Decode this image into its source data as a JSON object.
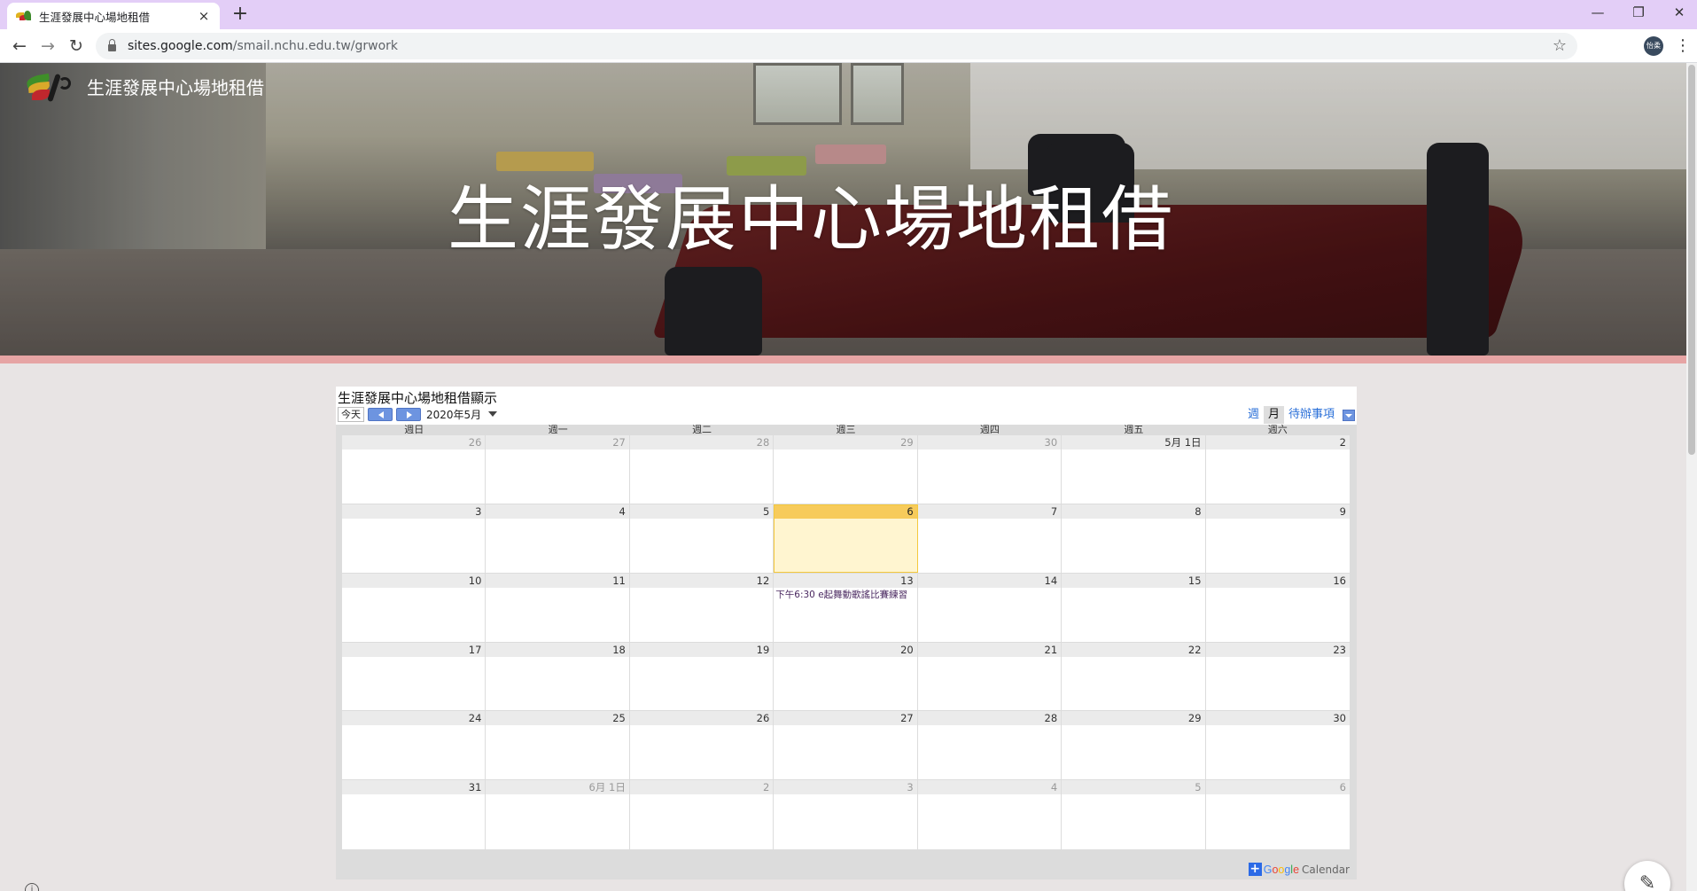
{
  "browser": {
    "tab_title": "生涯發展中心場地租借",
    "tab_close": "×",
    "new_tab": "+",
    "url_domain": "sites.google.com",
    "url_path": "/smail.nchu.edu.tw/grwork",
    "avatar_text": "怡柔",
    "controls": {
      "minimize": "—",
      "restore": "❐",
      "close": "✕"
    },
    "nav": {
      "back": "←",
      "forward": "→",
      "reload": "↻",
      "star": "☆",
      "menu": "⋮"
    }
  },
  "site": {
    "name": "生涯發展中心場地租借",
    "hero_title": "生涯發展中心場地租借",
    "accent_color": "#e6a4a4"
  },
  "calendar": {
    "title": "生涯發展中心場地租借顯示",
    "today_button": "今天",
    "month_label": "2020年5月",
    "views": {
      "week": "週",
      "month": "月",
      "agenda": "待辦事項"
    },
    "weekdays": [
      "週日",
      "週一",
      "週二",
      "週三",
      "週四",
      "週五",
      "週六"
    ],
    "weeks": [
      [
        "26",
        "27",
        "28",
        "29",
        "30",
        "5月 1日",
        "2"
      ],
      [
        "3",
        "4",
        "5",
        "6",
        "7",
        "8",
        "9"
      ],
      [
        "10",
        "11",
        "12",
        "13",
        "14",
        "15",
        "16"
      ],
      [
        "17",
        "18",
        "19",
        "20",
        "21",
        "22",
        "23"
      ],
      [
        "24",
        "25",
        "26",
        "27",
        "28",
        "29",
        "30"
      ],
      [
        "31",
        "6月 1日",
        "2",
        "3",
        "4",
        "5",
        "6"
      ]
    ],
    "other_month_cells": [
      "0-0",
      "0-1",
      "0-2",
      "0-3",
      "0-4",
      "5-1",
      "5-2",
      "5-3",
      "5-4",
      "5-5",
      "5-6"
    ],
    "today_cell": "1-3",
    "event": {
      "cell": "2-3",
      "text": "下午6:30 e起舞動歌謠比賽練習"
    },
    "footer": {
      "plus": "+",
      "brand": "Google",
      "product": "Calendar"
    }
  },
  "edit_fab_icon": "pencil-icon",
  "info_icon": "info-icon"
}
